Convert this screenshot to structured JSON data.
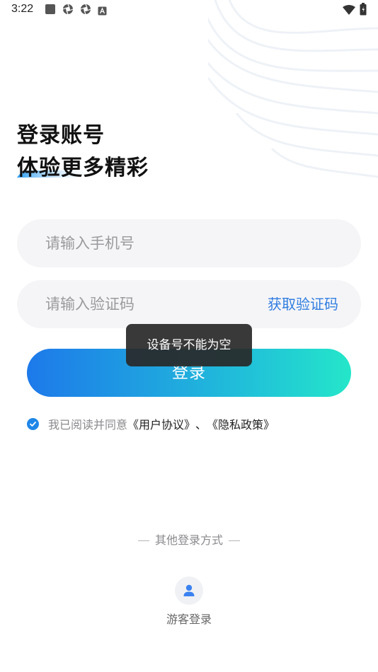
{
  "status_bar": {
    "time": "3:22",
    "left_icons": [
      "square-notification-icon",
      "aperture-icon",
      "aperture-icon",
      "a-box-icon"
    ],
    "right_icons": [
      "wifi-icon",
      "battery-icon"
    ]
  },
  "title": {
    "line1": "登录账号",
    "line2": "体验更多精彩"
  },
  "form": {
    "phone_placeholder": "请输入手机号",
    "code_placeholder": "请输入验证码",
    "get_code_label": "获取验证码",
    "login_label": "登录"
  },
  "toast": {
    "message": "设备号不能为空"
  },
  "agreement": {
    "checked": true,
    "prefix": "我已阅读并同意",
    "user_agreement": "《用户协议》",
    "separator": "、",
    "privacy_policy": "《隐私政策》"
  },
  "other_login": {
    "title": "其他登录方式",
    "guest_label": "游客登录",
    "guest_icon": "person-icon"
  },
  "colors": {
    "accent": "#2f7de1",
    "gradient_start": "#1d79ea",
    "gradient_end": "#24e6c9",
    "check": "#1f86e8"
  }
}
